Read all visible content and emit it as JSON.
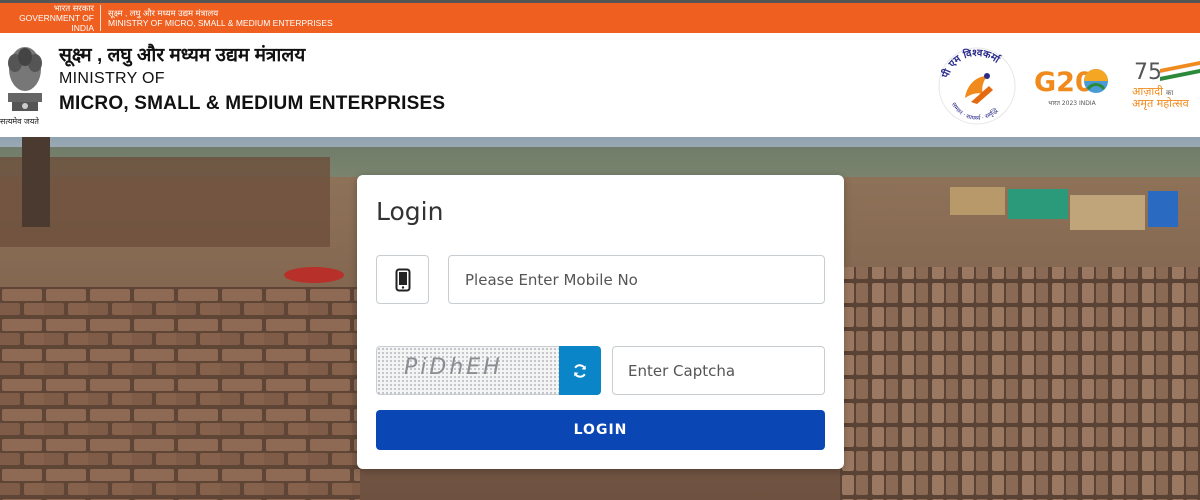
{
  "gov_strip": {
    "left_hindi": "भारत सरकार",
    "left_english": "GOVERNMENT OF INDIA",
    "right_hindi": "सूक्ष्म , लघु और मध्यम उद्यम मंत्रालय",
    "right_english": "MINISTRY OF MICRO, SMALL & MEDIUM ENTERPRISES"
  },
  "header": {
    "title_hindi": "सूक्ष्म , लघु और मध्यम उद्यम मंत्रालय",
    "title_ministry": "MINISTRY OF",
    "title_main": "MICRO, SMALL & MEDIUM ENTERPRISES",
    "emblem_motto": "सत्यमेव जयते",
    "logos": {
      "vishwakarma": "पी एम विश्वकर्मा",
      "vishwakarma_tagline": "सम्मान · सामर्थ्य · समृद्धि",
      "g20": "G20",
      "g20_tagline": "भारत 2023 INDIA",
      "azadi_number": "75",
      "azadi_line1": "आज़ादी",
      "azadi_line1_suffix": "का",
      "azadi_line2": "अमृत महोत्सव"
    }
  },
  "login": {
    "title": "Login",
    "mobile_placeholder": "Please Enter Mobile No",
    "captcha_text": "PiDhEH",
    "captcha_placeholder": "Enter Captcha",
    "login_button": "LOGIN"
  },
  "colors": {
    "orange_strip": "#ef5f1f",
    "refresh_blue": "#0a86c8",
    "login_blue": "#0b46b5"
  },
  "icons": {
    "phone": "mobile-phone-icon",
    "refresh": "refresh-icon"
  }
}
